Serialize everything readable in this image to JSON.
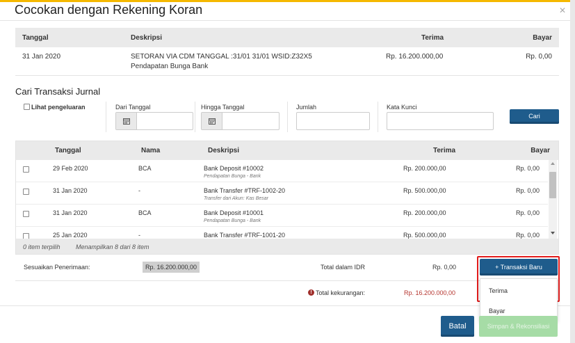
{
  "modal": {
    "title": "Cocokan dengan Rekening Koran",
    "close_icon": "close-icon"
  },
  "statement": {
    "headers": {
      "date": "Tanggal",
      "desc": "Deskripsi",
      "receive": "Terima",
      "pay": "Bayar"
    },
    "row": {
      "date": "31 Jan 2020",
      "desc": "SETORAN VIA CDM TANGGAL :31/01 31/01 WSID:Z32X5",
      "desc_sub": "Pendapatan Bunga Bank",
      "receive": "Rp. 16.200.000,00",
      "pay": "Rp. 0,00"
    }
  },
  "search": {
    "title": "Cari Transaksi Jurnal",
    "show_expense_label": "Lihat pengeluaran",
    "from_date_label": "Dari Tanggal",
    "to_date_label": "Hingga Tanggal",
    "amount_label": "Jumlah",
    "keyword_label": "Kata Kunci",
    "search_button": "Cari"
  },
  "journal": {
    "headers": {
      "date": "Tanggal",
      "name": "Nama",
      "desc": "Deskripsi",
      "receive": "Terima",
      "pay": "Bayar"
    },
    "rows": [
      {
        "date": "29 Feb 2020",
        "name": "BCA",
        "desc": "Bank Deposit #10002",
        "desc_sub": "Pendapatan Bunga - Bank",
        "receive": "Rp. 200.000,00",
        "pay": "Rp. 0,00"
      },
      {
        "date": "31 Jan 2020",
        "name": "-",
        "desc": "Bank Transfer #TRF-1002-20",
        "desc_sub": "Transfer dari Akun: Kas Besar",
        "receive": "Rp. 500.000,00",
        "pay": "Rp. 0,00"
      },
      {
        "date": "31 Jan 2020",
        "name": "BCA",
        "desc": "Bank Deposit #10001",
        "desc_sub": "Pendapatan Bunga - Bank",
        "receive": "Rp. 200.000,00",
        "pay": "Rp. 0,00"
      },
      {
        "date": "25 Jan 2020",
        "name": "-",
        "desc": "Bank Transfer #TRF-1001-20",
        "desc_sub": "",
        "receive": "Rp. 500.000,00",
        "pay": "Rp. 0,00"
      }
    ],
    "footer": {
      "selected": "0 item terpilih",
      "showing": "Menampilkan 8 dari 8 item"
    }
  },
  "summary": {
    "adjust_label": "Sesuaikan Penerimaan:",
    "adjust_value": "Rp. 16.200.000,00",
    "total_label": "Total dalam IDR",
    "total_value": "Rp. 0,00",
    "shortage_label": "Total kekurangan:",
    "shortage_value": "Rp. 16.200.000,00",
    "shortage_value_color": "#b5352f"
  },
  "new_txn": {
    "button": "+ Transaksi Baru",
    "menu": [
      "Terima",
      "Bayar"
    ]
  },
  "footer_buttons": {
    "cancel": "Batal",
    "save": "Simpan & Rekonsiliasi"
  }
}
